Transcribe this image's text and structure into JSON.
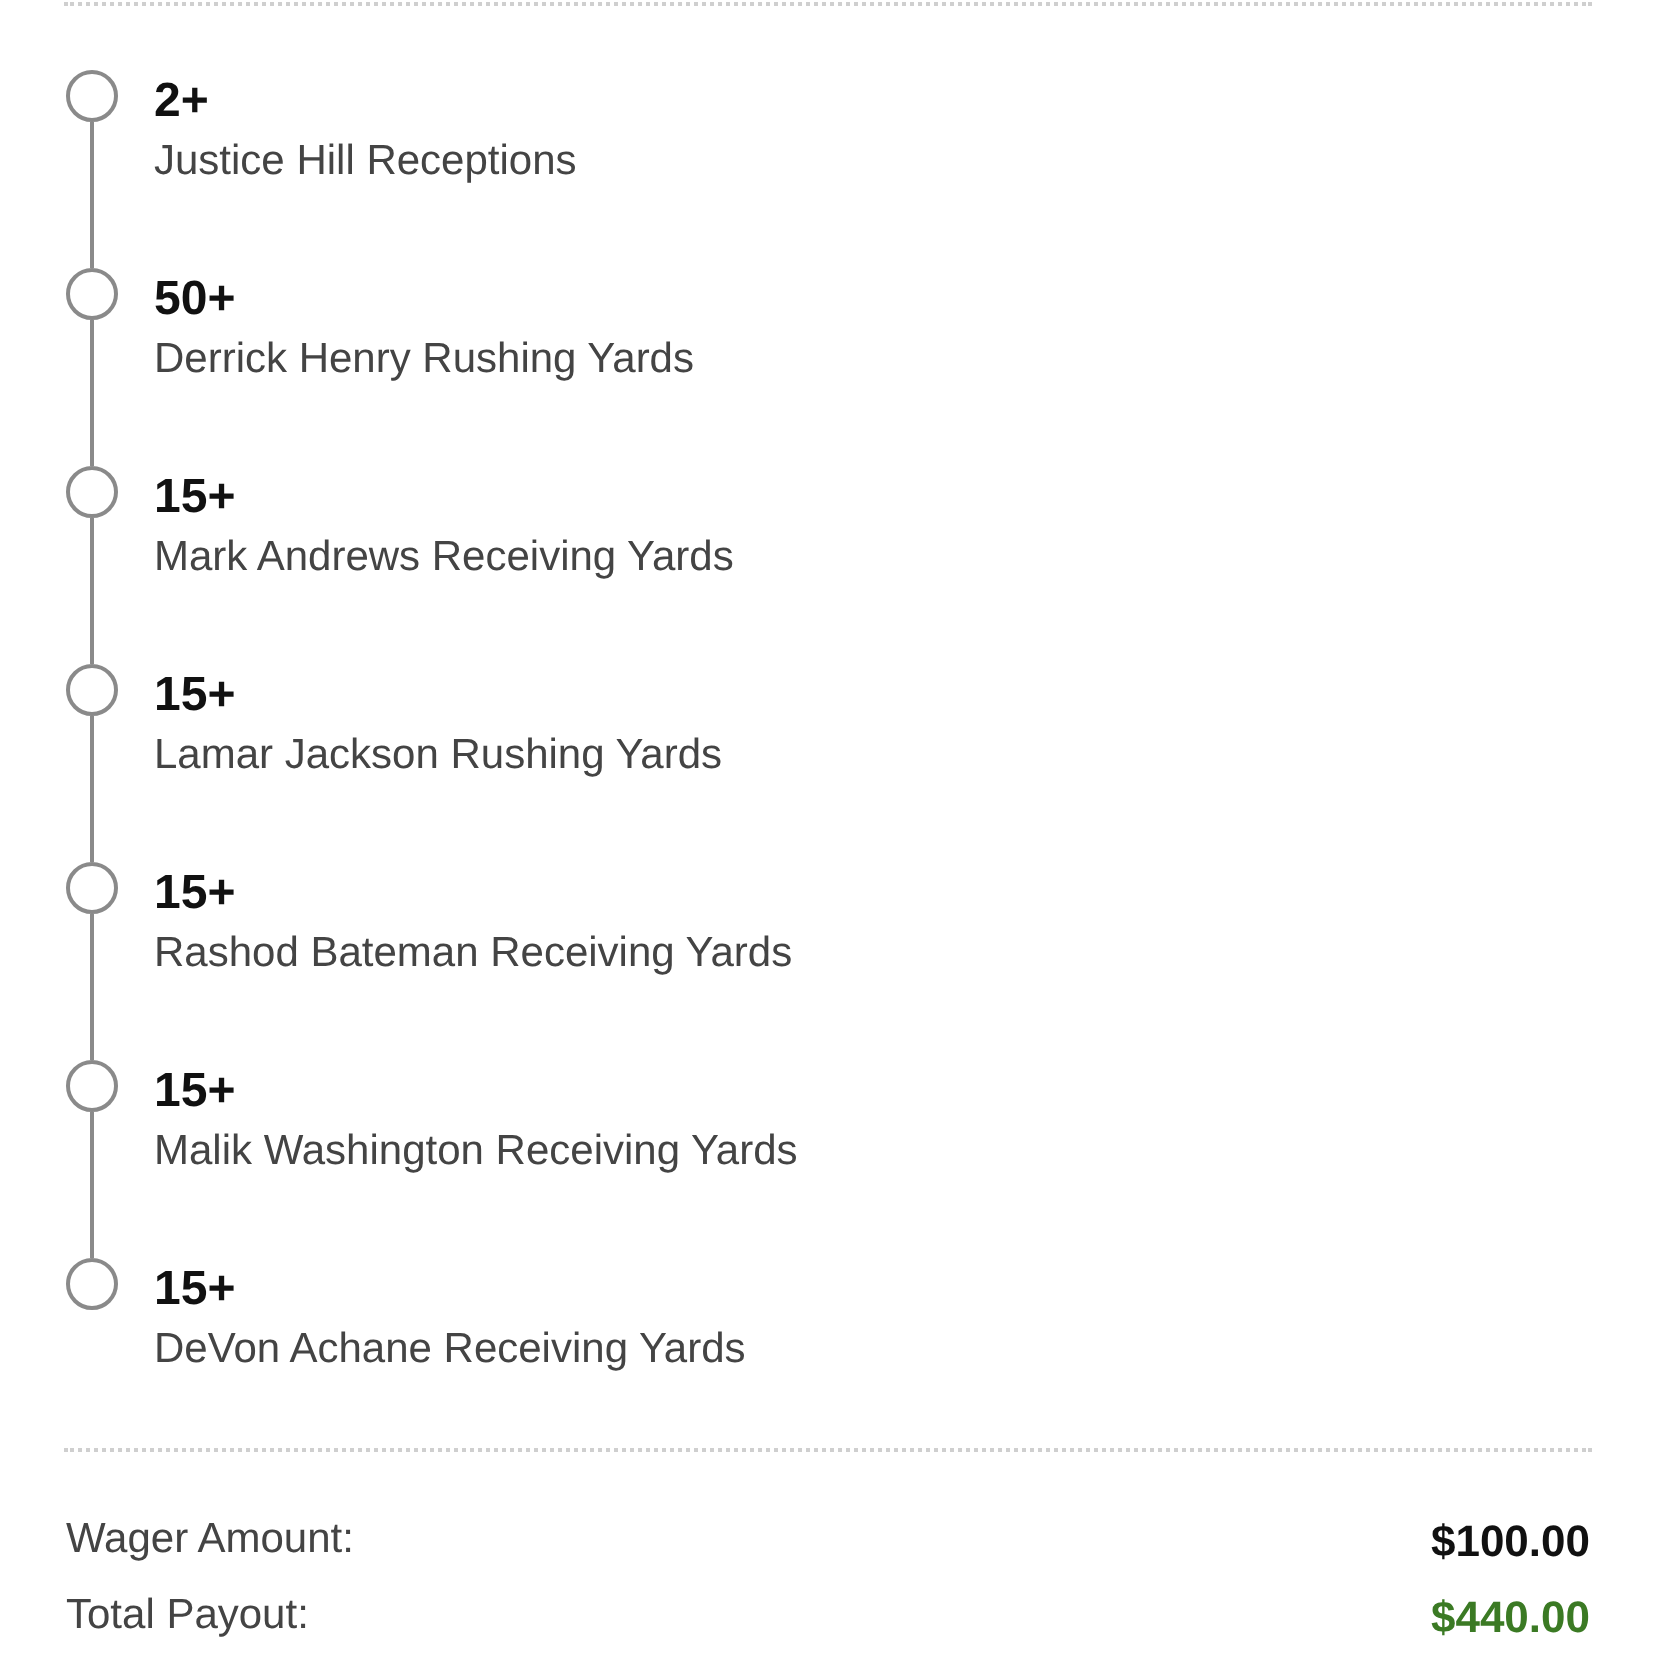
{
  "legs": [
    {
      "line": "2+",
      "market": "Justice Hill Receptions"
    },
    {
      "line": "50+",
      "market": "Derrick Henry Rushing Yards"
    },
    {
      "line": "15+",
      "market": "Mark Andrews Receiving Yards"
    },
    {
      "line": "15+",
      "market": "Lamar Jackson Rushing Yards"
    },
    {
      "line": "15+",
      "market": "Rashod Bateman Receiving Yards"
    },
    {
      "line": "15+",
      "market": "Malik Washington Receiving Yards"
    },
    {
      "line": "15+",
      "market": "DeVon Achane Receiving Yards"
    }
  ],
  "summary": [
    {
      "kind": "wager",
      "label": "Wager Amount:",
      "value": "$100.00"
    },
    {
      "kind": "payout",
      "label": "Total Payout:",
      "value": "$440.00"
    }
  ]
}
